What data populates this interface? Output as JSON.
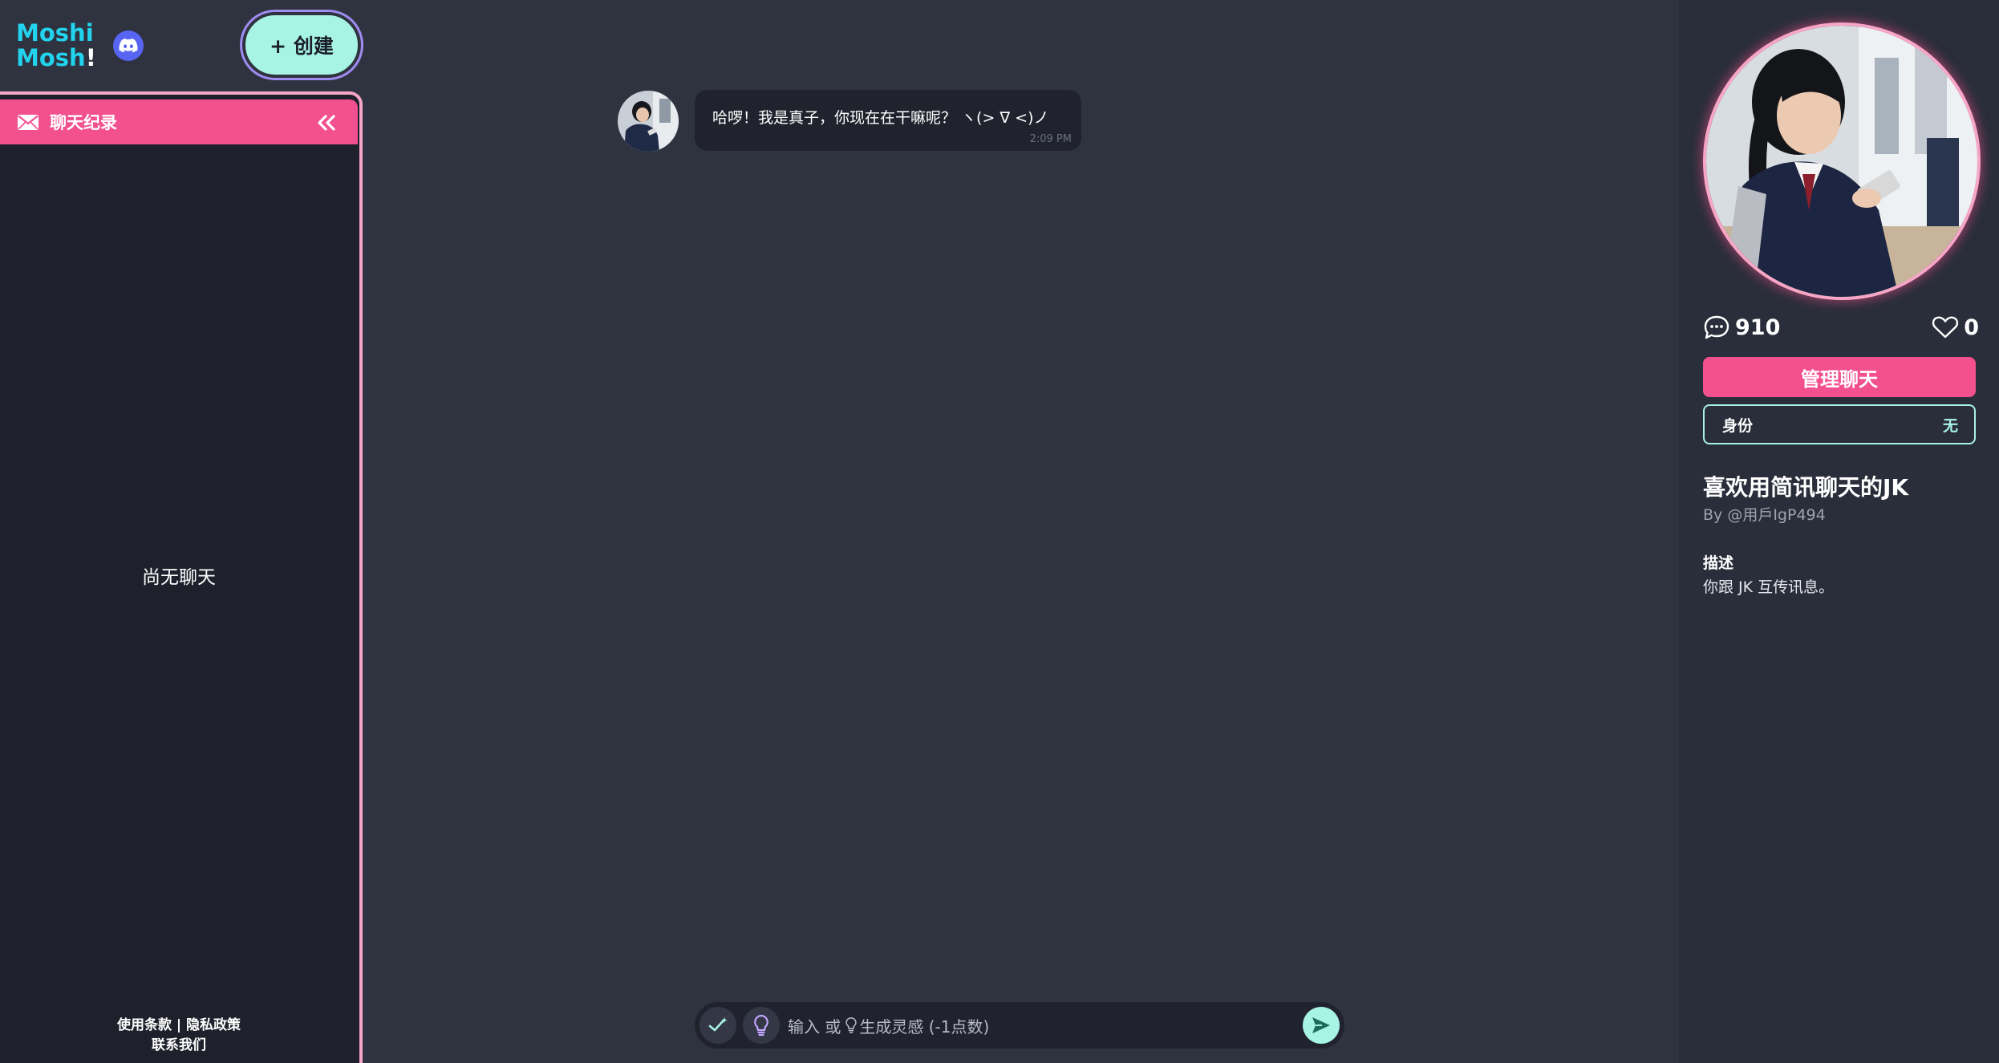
{
  "brand": {
    "line1": "Moshi",
    "line2": "Mosh",
    "line2_suffix": "!"
  },
  "header": {
    "create_label": "+ 创建"
  },
  "sidebar": {
    "title": "聊天纪录",
    "empty_message": "尚无聊天",
    "footer": {
      "terms": "使用条款",
      "separator": " | ",
      "privacy": "隐私政策",
      "contact": "联系我们"
    }
  },
  "chat": {
    "messages": [
      {
        "sender": "character",
        "text": "哈啰！我是真子，你现在在干嘛呢？ ヽ(> ∇ <)ノ",
        "time": "2:09 PM"
      }
    ]
  },
  "input": {
    "placeholder_prefix": "输入 或",
    "placeholder_suffix": "生成灵感 (-1点数)"
  },
  "profile": {
    "comment_count": "910",
    "like_count": "0",
    "manage_label": "管理聊天",
    "identity_label": "身份",
    "identity_value": "无",
    "name": "喜欢用简讯聊天的JK",
    "author": "By @用戶IgP494",
    "description_label": "描述",
    "description": "你跟 JK 互传讯息。"
  },
  "colors": {
    "background": "#2f3340",
    "sidebar": "#1e202b",
    "accent_pink": "#f2508e",
    "accent_mint": "#a7f3e4",
    "brand_cyan": "#22d3ee",
    "discord": "#5865f2"
  },
  "icons": [
    "discord-icon",
    "mail-icon",
    "collapse-chevrons-icon",
    "magic-check-icon",
    "lightbulb-icon",
    "send-icon",
    "comment-icon",
    "heart-icon"
  ]
}
